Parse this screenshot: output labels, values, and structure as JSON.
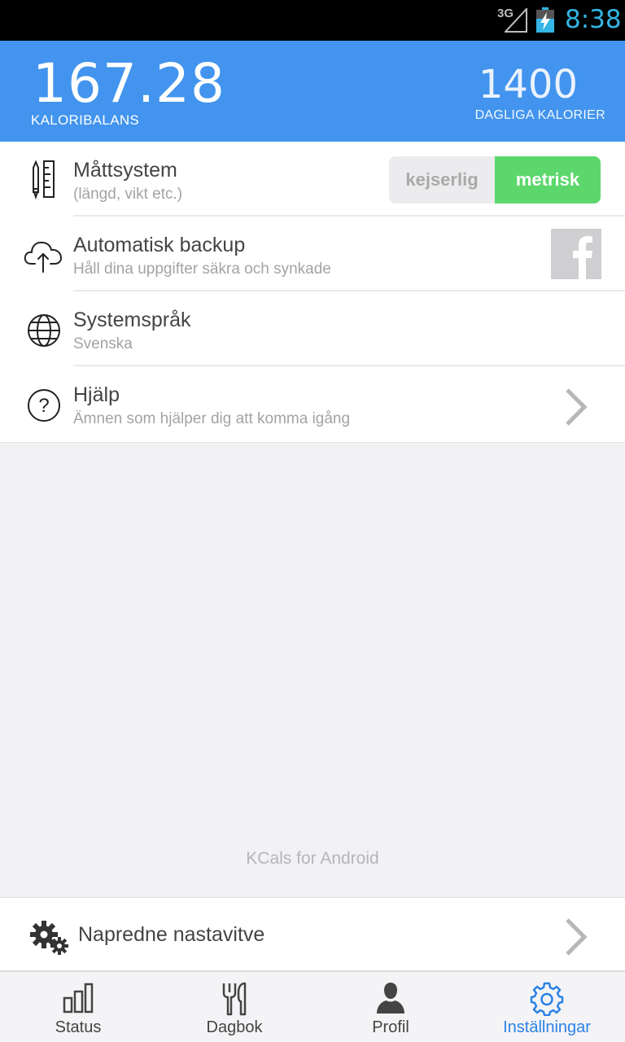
{
  "status_bar": {
    "network": "3G",
    "time": "8:38"
  },
  "header": {
    "balance_value": "167.28",
    "balance_label": "KALORIBALANS",
    "daily_value": "1400",
    "daily_label": "DAGLIGA KALORIER"
  },
  "settings": [
    {
      "title": "Måttsystem",
      "subtitle": "(längd, vikt etc.)",
      "icon": "ruler-pencil-icon",
      "options": [
        "kejserlig",
        "metrisk"
      ],
      "selected": "metrisk"
    },
    {
      "title": "Automatisk backup",
      "subtitle": "Håll dina uppgifter säkra och synkade",
      "icon": "cloud-upload-icon",
      "action_icon": "facebook-icon"
    },
    {
      "title": "Systemspråk",
      "subtitle": "Svenska",
      "icon": "globe-icon"
    },
    {
      "title": "Hjälp",
      "subtitle": "Ämnen som hjälper dig att komma igång",
      "icon": "help-icon",
      "action_icon": "chevron-right-icon"
    }
  ],
  "footer_note": "KCals for Android",
  "advanced": {
    "label": "Napredne nastavitve",
    "icon": "gears-icon"
  },
  "nav": {
    "tabs": [
      {
        "label": "Status",
        "icon": "bar-chart-icon"
      },
      {
        "label": "Dagbok",
        "icon": "fork-knife-icon"
      },
      {
        "label": "Profil",
        "icon": "user-icon"
      },
      {
        "label": "Inställningar",
        "icon": "gear-icon"
      }
    ],
    "active": "Inställningar"
  },
  "colors": {
    "header": "#4294ee",
    "accent": "#2b82e6",
    "toggle_on": "#5cd76c",
    "clock": "#33b5e5"
  }
}
